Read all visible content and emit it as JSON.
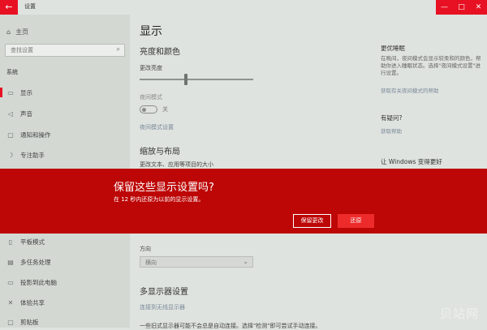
{
  "window": {
    "title": "设置",
    "back_icon": "←",
    "minimize": "—",
    "maximize": "□",
    "close": "✕"
  },
  "sidebar": {
    "home": "主页",
    "search_placeholder": "查找设置",
    "section": "系统",
    "items": [
      {
        "label": "显示",
        "icon": "display-icon",
        "glyph": "▭",
        "active": true
      },
      {
        "label": "声音",
        "icon": "sound-icon",
        "glyph": "◁"
      },
      {
        "label": "通知和操作",
        "icon": "notifications-icon",
        "glyph": "▢"
      },
      {
        "label": "专注助手",
        "icon": "focus-assist-icon",
        "glyph": "☽"
      },
      {
        "label": "平板模式",
        "icon": "tablet-mode-icon",
        "glyph": "▯"
      },
      {
        "label": "多任务处理",
        "icon": "multitasking-icon",
        "glyph": "▤"
      },
      {
        "label": "投影到此电脑",
        "icon": "projecting-icon",
        "glyph": "▭"
      },
      {
        "label": "体验共享",
        "icon": "shared-experiences-icon",
        "glyph": "✕"
      },
      {
        "label": "剪贴板",
        "icon": "clipboard-icon",
        "glyph": "▢"
      }
    ]
  },
  "content": {
    "title": "显示",
    "brightness_heading": "亮度和颜色",
    "brightness_label": "更改亮度",
    "brightness_value": 40,
    "night_light_label": "夜间模式",
    "night_light_state": "关",
    "night_light_link": "夜间模式设置",
    "scale_heading": "缩放与布局",
    "scale_label": "更改文本、应用等项目的大小",
    "orientation_label": "方向",
    "orientation_value": "横向",
    "multi_display_heading": "多显示器设置",
    "wireless_link": "连接到无线显示器",
    "footer_text": "一些旧式显示器可能不会总是自动连接。选择\"检测\"即可尝试手动连接。"
  },
  "right": {
    "sleep_heading": "更优睡眠",
    "sleep_text": "在晚间，夜间模式会显示较柔和的颜色，帮助你进入睡眠状态。选择\"夜间模式设置\"进行设置。",
    "sleep_link": "获取有关夜间模式的帮助",
    "question_heading": "有疑问?",
    "help_link": "获取帮助",
    "improve_heading": "让 Windows 变得更好"
  },
  "banner": {
    "title": "保留这些显示设置吗?",
    "subtitle": "在 12 秒内还原为以前的显示设置。",
    "keep_button": "保留更改",
    "revert_button": "还原"
  },
  "watermark": "贝站网",
  "colors": {
    "accent": "#e81123",
    "banner": "#bd0606",
    "revert": "#ee2b2b"
  }
}
